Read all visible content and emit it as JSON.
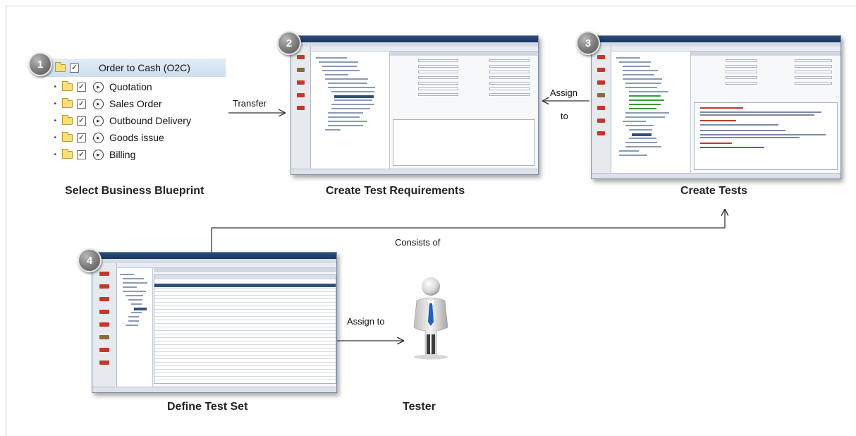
{
  "steps": [
    {
      "number": "1",
      "label": "Select Business Blueprint"
    },
    {
      "number": "2",
      "label": "Create Test Requirements"
    },
    {
      "number": "3",
      "label": "Create Tests"
    },
    {
      "number": "4",
      "label": "Define Test Set"
    }
  ],
  "blueprint": {
    "root": "Order to Cash (O2C)",
    "items": [
      "Quotation",
      "Sales Order",
      "Outbound Delivery",
      "Goods issue",
      "Billing"
    ]
  },
  "arrows": {
    "transfer": "Transfer",
    "assign_to_line1": "Assign",
    "assign_to_line2": "to",
    "consists_of": "Consists of",
    "assign_to_tester": "Assign to"
  },
  "tester": {
    "label": "Tester"
  },
  "colors": {
    "accent_blue": "#2c4c7a",
    "tree_highlight": "#dbe7f3",
    "tie_blue": "#1f5fbf"
  }
}
